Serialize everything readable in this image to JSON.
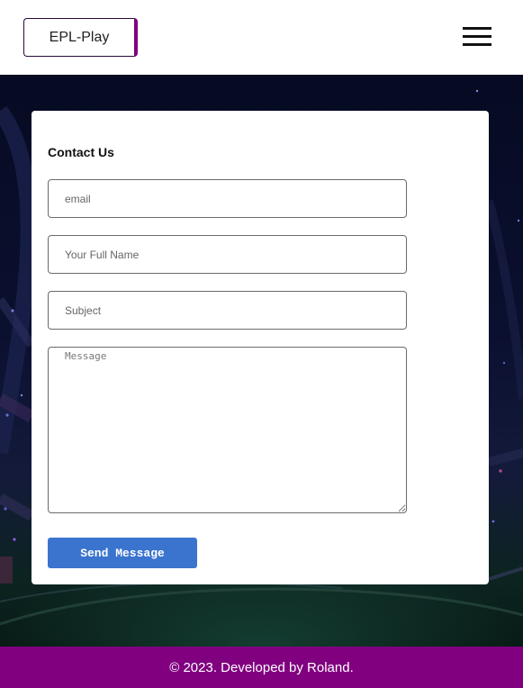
{
  "header": {
    "logo_text": "EPL-Play",
    "menu_icon": "hamburger-menu-icon"
  },
  "contact": {
    "title": "Contact Us",
    "email_placeholder": "email",
    "name_placeholder": "Your Full Name",
    "subject_placeholder": "Subject",
    "message_placeholder": "Message",
    "send_label": "Send Message"
  },
  "footer": {
    "text": "© 2023. Developed by Roland."
  },
  "colors": {
    "brand": "#800080",
    "button": "#3b74cf"
  }
}
